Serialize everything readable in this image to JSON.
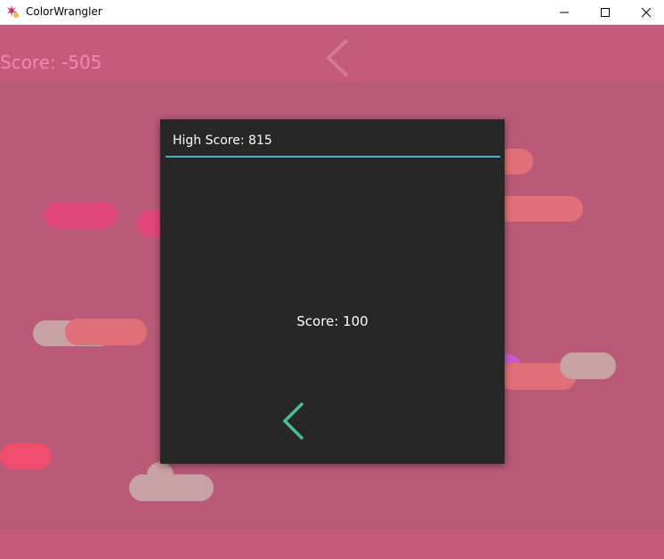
{
  "window": {
    "title": "ColorWrangler",
    "controls": [
      "minimize-icon",
      "maximize-icon",
      "close-icon"
    ]
  },
  "game": {
    "score_label": "Score: -505",
    "back_icon": "chevron-left-icon"
  },
  "dialog": {
    "high_score_label": "High Score: 815",
    "score_label": "Score: 100",
    "back_icon": "chevron-left-icon"
  },
  "colors": {
    "background": "#b95a78",
    "strip": "#c25b7c",
    "dialog_bg": "#272727",
    "accent_rule": "#3fb4c7",
    "back_button": "#4bbd9a",
    "score_text": "#f08aad"
  }
}
